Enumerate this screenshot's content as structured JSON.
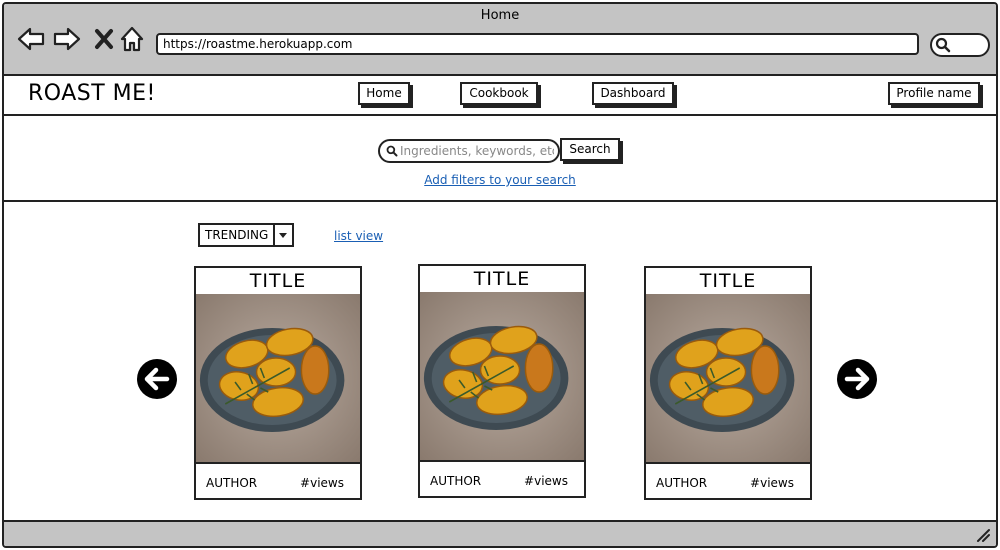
{
  "window": {
    "title": "Home"
  },
  "browser": {
    "url": "https://roastme.herokuapp.com"
  },
  "app": {
    "logo": "ROAST ME!",
    "nav": {
      "home": "Home",
      "cookbook": "Cookbook",
      "dashboard": "Dashboard"
    },
    "profile": "Profile name"
  },
  "search": {
    "placeholder": "Ingredients, keywords, etc",
    "button": "Search",
    "filters_link": "Add filters to your search"
  },
  "controls": {
    "sort_selected": "TRENDING",
    "list_view": "list view"
  },
  "cards": [
    {
      "title": "TITLE",
      "author": "AUTHOR",
      "views": "#views"
    },
    {
      "title": "TITLE",
      "author": "AUTHOR",
      "views": "#views"
    },
    {
      "title": "TITLE",
      "author": "AUTHOR",
      "views": "#views"
    }
  ],
  "icons": {
    "back": "back-arrow-icon",
    "forward": "forward-arrow-icon",
    "stop": "close-icon",
    "home": "home-icon",
    "search": "search-icon",
    "carousel_prev": "arrow-left-circle-icon",
    "carousel_next": "arrow-right-circle-icon",
    "resize": "resize-grip-icon"
  },
  "colors": {
    "chrome": "#c4c4c4",
    "link": "#1a5fb4"
  }
}
